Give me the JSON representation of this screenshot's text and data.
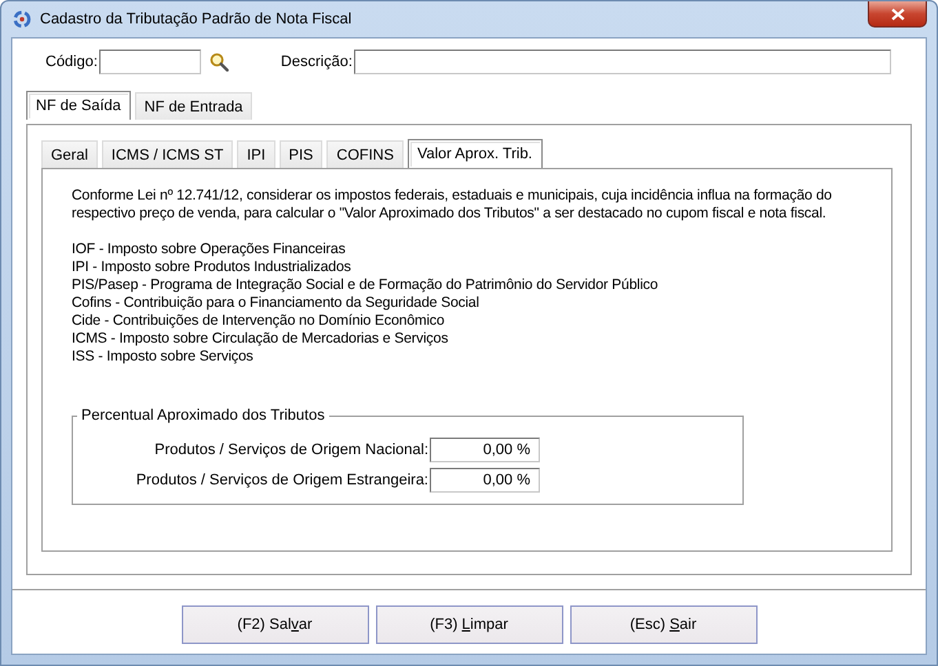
{
  "window": {
    "title": "Cadastro da Tributação Padrão de Nota Fiscal"
  },
  "header": {
    "code_label": "Código:",
    "description_label": "Descrição:"
  },
  "outer_tabs": [
    {
      "label": "NF de Saída",
      "selected": true
    },
    {
      "label": "NF de Entrada",
      "selected": false
    }
  ],
  "inner_tabs": [
    {
      "label": "Geral",
      "selected": false
    },
    {
      "label": "ICMS / ICMS ST",
      "selected": false
    },
    {
      "label": "IPI",
      "selected": false
    },
    {
      "label": "PIS",
      "selected": false
    },
    {
      "label": "COFINS",
      "selected": false
    },
    {
      "label": "Valor Aprox. Trib.",
      "selected": true
    }
  ],
  "intro": "Conforme Lei nº 12.741/12, considerar os impostos federais, estaduais e municipais, cuja incidência influa na formação do respectivo preço de venda, para calcular o \"Valor Aproximado dos Tributos\" a ser destacado no cupom fiscal e nota fiscal.",
  "taxes": [
    "IOF - Imposto sobre Operações Financeiras",
    "IPI - Imposto sobre Produtos Industrializados",
    "PIS/Pasep - Programa de Integração Social e de Formação do Patrimônio do Servidor Público",
    "Cofins - Contribuição para o Financiamento da Seguridade Social",
    "Cide - Contribuições de Intervenção no Domínio Econômico",
    "ICMS - Imposto sobre Circulação de Mercadorias e Serviços",
    "ISS - Imposto sobre Serviços"
  ],
  "percent_group": {
    "title": "Percentual Aproximado dos Tributos",
    "fields": [
      {
        "label": "Produtos / Serviços de Origem Nacional:",
        "value": "0,00 %"
      },
      {
        "label": "Produtos / Serviços de Origem Estrangeira:",
        "value": "0,00 %"
      }
    ]
  },
  "buttons": [
    {
      "before": "(F2) Sal",
      "key": "v",
      "after": "ar"
    },
    {
      "before": "(F3) ",
      "key": "L",
      "after": "impar"
    },
    {
      "before": "(Esc) ",
      "key": "S",
      "after": "air"
    }
  ]
}
